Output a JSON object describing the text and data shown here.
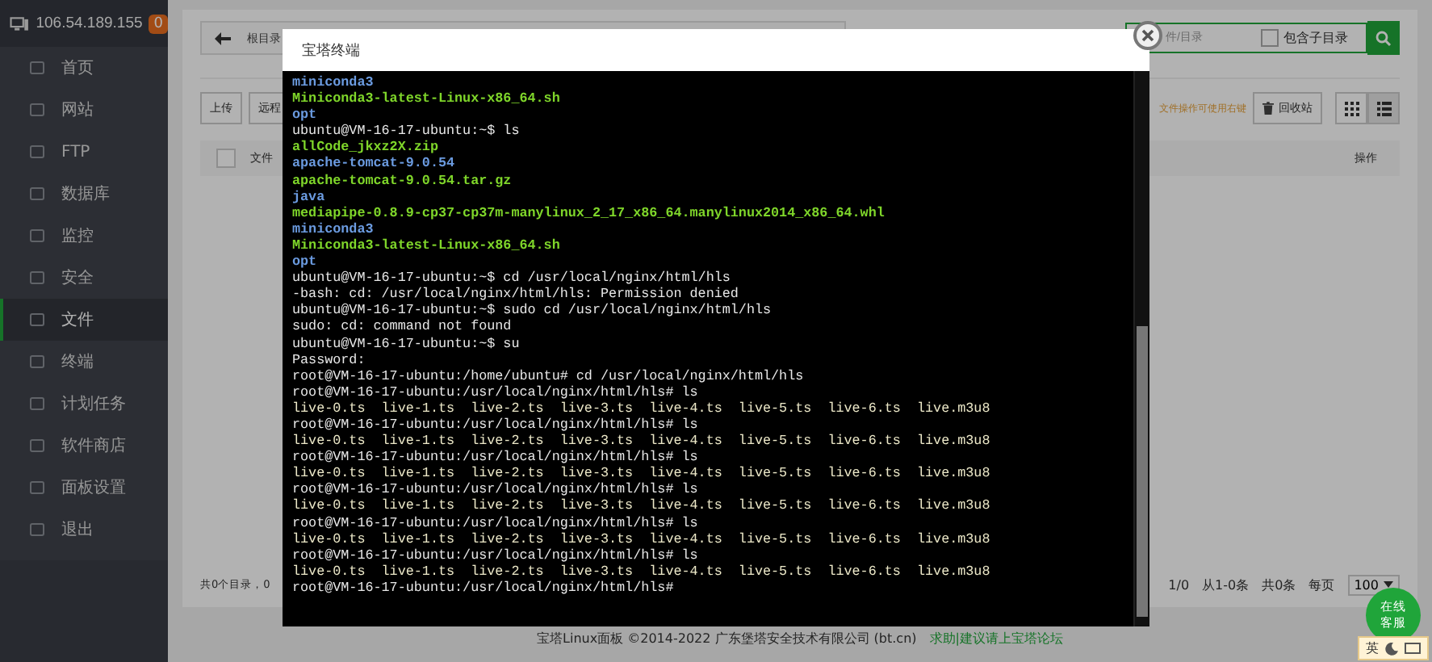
{
  "sidebar": {
    "ip": "106.54.189.155",
    "badge": "0",
    "items": [
      {
        "label": "首页",
        "selected": false
      },
      {
        "label": "网站",
        "selected": false
      },
      {
        "label": "FTP",
        "selected": false
      },
      {
        "label": "数据库",
        "selected": false
      },
      {
        "label": "监控",
        "selected": false
      },
      {
        "label": "安全",
        "selected": false
      },
      {
        "label": "文件",
        "selected": true
      },
      {
        "label": "终端",
        "selected": false
      },
      {
        "label": "计划任务",
        "selected": false
      },
      {
        "label": "软件商店",
        "selected": false
      },
      {
        "label": "面板设置",
        "selected": false
      },
      {
        "label": "退出",
        "selected": false
      }
    ]
  },
  "file_manager": {
    "path": "根目录",
    "search_placeholder": "件/目录",
    "include_subdirs": {
      "label": "包含子目录",
      "checked": false
    },
    "toolbar_buttons": [
      "上传",
      "远程"
    ],
    "tip": "文件操作可使用右键",
    "recycle_bin": "回收站",
    "views": [
      {
        "kind": "grid",
        "selected": false
      },
      {
        "kind": "list",
        "selected": true
      }
    ],
    "columns": {
      "column_1": "文件",
      "actions": "操作"
    },
    "select_all": {
      "checked": false
    },
    "summary": "共0个目录，0",
    "pagination": {
      "page": "1/0",
      "range": "从1-0条",
      "total": "共0条",
      "per_page_label": "每页",
      "per_page": "100"
    }
  },
  "terminal": {
    "title": "宝塔终端",
    "lines": [
      {
        "kind": "dir",
        "text": "miniconda3"
      },
      {
        "kind": "file",
        "text": "Miniconda3-latest-Linux-x86_64.sh"
      },
      {
        "kind": "dir",
        "text": "opt"
      },
      {
        "kind": "plain",
        "text": "ubuntu@VM-16-17-ubuntu:~$ ls"
      },
      {
        "kind": "file",
        "text": "allCode_jkxz2X.zip"
      },
      {
        "kind": "dir",
        "text": "apache-tomcat-9.0.54"
      },
      {
        "kind": "file",
        "text": "apache-tomcat-9.0.54.tar.gz"
      },
      {
        "kind": "dir",
        "text": "java"
      },
      {
        "kind": "file",
        "text": "mediapipe-0.8.9-cp37-cp37m-manylinux_2_17_x86_64.manylinux2014_x86_64.whl"
      },
      {
        "kind": "dir",
        "text": "miniconda3"
      },
      {
        "kind": "file",
        "text": "Miniconda3-latest-Linux-x86_64.sh"
      },
      {
        "kind": "dir",
        "text": "opt"
      },
      {
        "kind": "plain",
        "text": "ubuntu@VM-16-17-ubuntu:~$ cd /usr/local/nginx/html/hls"
      },
      {
        "kind": "plain",
        "text": "-bash: cd: /usr/local/nginx/html/hls: Permission denied"
      },
      {
        "kind": "plain",
        "text": "ubuntu@VM-16-17-ubuntu:~$ sudo cd /usr/local/nginx/html/hls"
      },
      {
        "kind": "plain",
        "text": "sudo: cd: command not found"
      },
      {
        "kind": "plain",
        "text": "ubuntu@VM-16-17-ubuntu:~$ su"
      },
      {
        "kind": "plain",
        "text": "Password:"
      },
      {
        "kind": "plain",
        "text": "root@VM-16-17-ubuntu:/home/ubuntu# cd /usr/local/nginx/html/hls"
      },
      {
        "kind": "plain",
        "text": "root@VM-16-17-ubuntu:/usr/local/nginx/html/hls# ls"
      },
      {
        "kind": "media",
        "text": "live-0.ts  live-1.ts  live-2.ts  live-3.ts  live-4.ts  live-5.ts  live-6.ts  live.m3u8"
      },
      {
        "kind": "plain",
        "text": "root@VM-16-17-ubuntu:/usr/local/nginx/html/hls# ls"
      },
      {
        "kind": "media",
        "text": "live-0.ts  live-1.ts  live-2.ts  live-3.ts  live-4.ts  live-5.ts  live-6.ts  live.m3u8"
      },
      {
        "kind": "plain",
        "text": "root@VM-16-17-ubuntu:/usr/local/nginx/html/hls# ls"
      },
      {
        "kind": "media",
        "text": "live-0.ts  live-1.ts  live-2.ts  live-3.ts  live-4.ts  live-5.ts  live-6.ts  live.m3u8"
      },
      {
        "kind": "plain",
        "text": "root@VM-16-17-ubuntu:/usr/local/nginx/html/hls# ls"
      },
      {
        "kind": "media",
        "text": "live-0.ts  live-1.ts  live-2.ts  live-3.ts  live-4.ts  live-5.ts  live-6.ts  live.m3u8"
      },
      {
        "kind": "plain",
        "text": "root@VM-16-17-ubuntu:/usr/local/nginx/html/hls# ls"
      },
      {
        "kind": "media",
        "text": "live-0.ts  live-1.ts  live-2.ts  live-3.ts  live-4.ts  live-5.ts  live-6.ts  live.m3u8"
      },
      {
        "kind": "plain",
        "text": "root@VM-16-17-ubuntu:/usr/local/nginx/html/hls# ls"
      },
      {
        "kind": "media",
        "text": "live-0.ts  live-1.ts  live-2.ts  live-3.ts  live-4.ts  live-5.ts  live-6.ts  live.m3u8"
      },
      {
        "kind": "plain",
        "text": "root@VM-16-17-ubuntu:/usr/local/nginx/html/hls#"
      }
    ]
  },
  "footer": {
    "copyright": "宝塔Linux面板 ©2014-2022 广东堡塔安全技术有限公司 (bt.cn)",
    "link": "求助|建议请上宝塔论坛"
  },
  "chat_button": "在线客服",
  "ime_toolbar": {
    "mode": "英"
  }
}
